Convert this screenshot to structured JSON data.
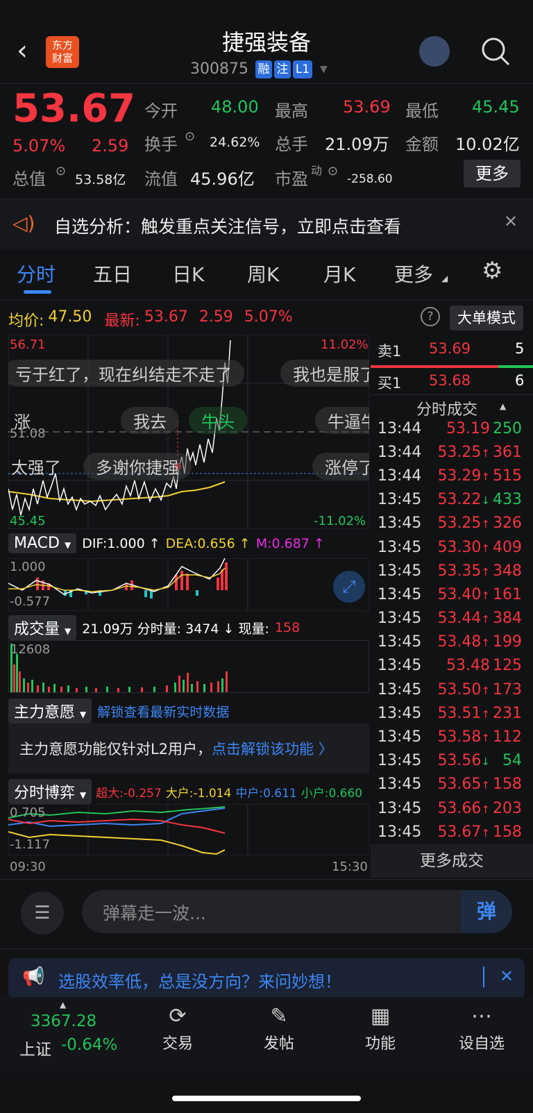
{
  "header": {
    "title": "捷强装备",
    "code": "300875",
    "badges": [
      "融",
      "注",
      "L1"
    ],
    "logo": "东方\n财富"
  },
  "quote": {
    "price": "53.67",
    "pct": "5.07%",
    "change": "2.59",
    "open_label": "今开",
    "open": "48.00",
    "high_label": "最高",
    "high": "53.69",
    "low_label": "最低",
    "low": "45.45",
    "turnover_label": "换手",
    "turnover": "24.62%",
    "vol_label": "总手",
    "vol": "21.09万",
    "amount_label": "金额",
    "amount": "10.02亿",
    "mcap_label": "总值",
    "mcap": "53.58亿",
    "float_label": "流值",
    "float": "45.96亿",
    "pe_label": "市盈",
    "pe_sup": "动",
    "pe": "-258.60",
    "more": "更多"
  },
  "notice": {
    "text": "自选分析：触发重点关注信号，立即点击查看"
  },
  "tabs": [
    "分时",
    "五日",
    "日K",
    "周K",
    "月K",
    "更多"
  ],
  "stats": {
    "avg_label": "均价:",
    "avg": "47.50",
    "last_label": "最新:",
    "last": "53.67",
    "chg": "2.59",
    "pct": "5.07%",
    "big_order": "大单模式"
  },
  "chart": {
    "hi": "56.71",
    "hi_pct": "11.02%",
    "mid": "51.08",
    "lo": "45.45",
    "lo_pct": "-11.02%",
    "start": "09:30",
    "end": "15:30"
  },
  "danmu": [
    "亏于红了，现在纠结走不走了",
    "我也是服了",
    "涨",
    "我去",
    "牛头",
    "牛逼牛",
    "太强了",
    "多谢你捷强",
    "涨停了"
  ],
  "macd": {
    "label": "MACD",
    "dif": "DIF:1.000 ↑",
    "dea": "DEA:0.656 ↑",
    "m": "M:0.687 ↑",
    "top": "1.000",
    "bot": "-0.577"
  },
  "volume": {
    "label": "成交量",
    "info": "21.09万 分时量: 3474 ↓ 现量:",
    "cur": "158",
    "top": "12608"
  },
  "zlyy": {
    "label": "主力意愿",
    "link": "解锁查看最新实时数据",
    "msg": "主力意愿功能仅针对L2用户，",
    "msg_link": "点击解锁该功能 〉"
  },
  "bo": {
    "label": "分时博弈",
    "cd": "超大:-0.257",
    "d": "大户:-1.014",
    "z": "中户:0.611",
    "x": "小户:0.660",
    "top": "0.705",
    "bot": "-1.117"
  },
  "orderbook": {
    "sell_label": "卖1",
    "sell_price": "53.69",
    "sell_vol": "5",
    "buy_label": "买1",
    "buy_price": "53.68",
    "buy_vol": "6"
  },
  "trades_title": "分时成交",
  "trades": [
    [
      "13:44",
      "53.19",
      "",
      "250",
      "g"
    ],
    [
      "13:44",
      "53.25",
      "↑",
      "361",
      "r"
    ],
    [
      "13:44",
      "53.29",
      "↑",
      "515",
      "r"
    ],
    [
      "13:45",
      "53.22",
      "↓",
      "433",
      "g"
    ],
    [
      "13:45",
      "53.25",
      "↑",
      "326",
      "r"
    ],
    [
      "13:45",
      "53.30",
      "↑",
      "409",
      "r"
    ],
    [
      "13:45",
      "53.35",
      "↑",
      "348",
      "r"
    ],
    [
      "13:45",
      "53.40",
      "↑",
      "161",
      "r"
    ],
    [
      "13:45",
      "53.44",
      "↑",
      "384",
      "r"
    ],
    [
      "13:45",
      "53.48",
      "↑",
      "199",
      "r"
    ],
    [
      "13:45",
      "53.48",
      "",
      "125",
      "r"
    ],
    [
      "13:45",
      "53.50",
      "↑",
      "173",
      "r"
    ],
    [
      "13:45",
      "53.51",
      "↑",
      "231",
      "r"
    ],
    [
      "13:45",
      "53.58",
      "↑",
      "112",
      "r"
    ],
    [
      "13:45",
      "53.56",
      "↓",
      "54",
      "g"
    ],
    [
      "13:45",
      "53.65",
      "↑",
      "158",
      "r"
    ],
    [
      "13:45",
      "53.66",
      "↑",
      "203",
      "r"
    ],
    [
      "13:45",
      "53.67",
      "↑",
      "158",
      "r"
    ]
  ],
  "more_trades": "更多成交",
  "comment": {
    "placeholder": "弹幕走一波...",
    "send": "弹"
  },
  "promo": {
    "text": "选股效率低，总是没方向？来问妙想！"
  },
  "index": {
    "value": "3367.28",
    "name": "上证",
    "pct": "-0.64%"
  },
  "nav": [
    "交易",
    "发帖",
    "功能",
    "设自选"
  ]
}
